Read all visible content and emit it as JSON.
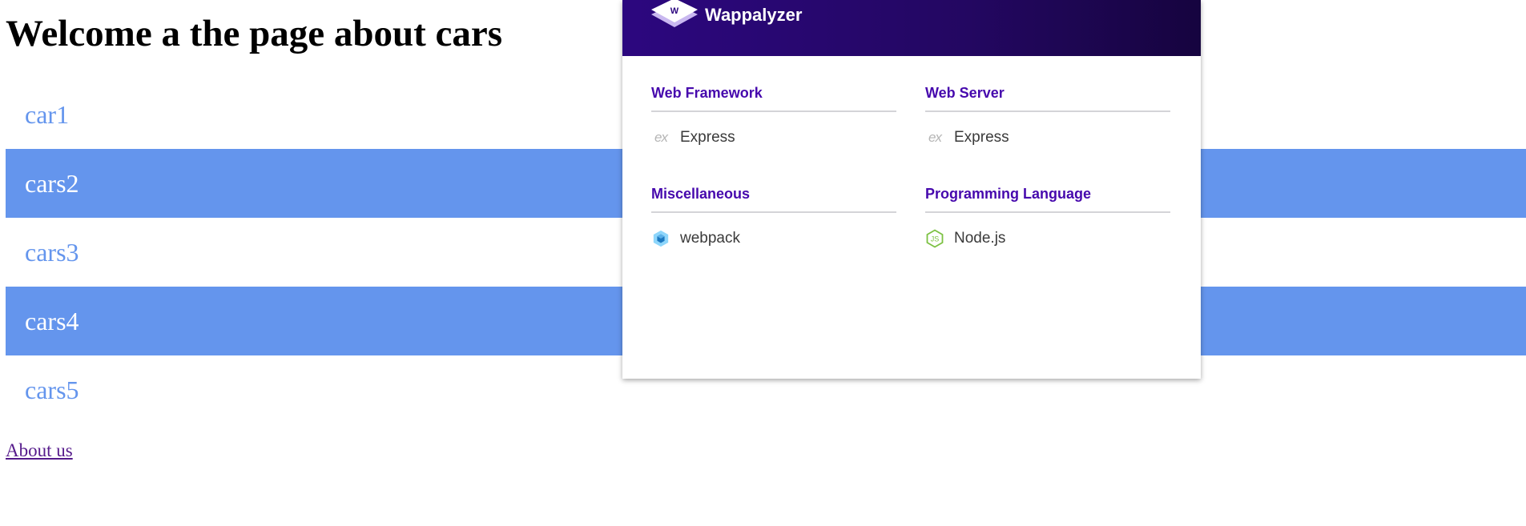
{
  "page": {
    "title": "Welcome a the page about cars",
    "cars": [
      {
        "label": "car1"
      },
      {
        "label": "cars2"
      },
      {
        "label": "cars3"
      },
      {
        "label": "cars4"
      },
      {
        "label": "cars5"
      }
    ],
    "about_link": "About us"
  },
  "wappalyzer": {
    "brand": "Wappalyzer",
    "categories": [
      {
        "title": "Web Framework",
        "tech": {
          "name": "Express",
          "icon": "express-icon",
          "glyph": "ex"
        }
      },
      {
        "title": "Web Server",
        "tech": {
          "name": "Express",
          "icon": "express-icon",
          "glyph": "ex"
        }
      },
      {
        "title": "Miscellaneous",
        "tech": {
          "name": "webpack",
          "icon": "webpack-icon"
        }
      },
      {
        "title": "Programming Language",
        "tech": {
          "name": "Node.js",
          "icon": "nodejs-icon"
        }
      }
    ]
  },
  "colors": {
    "car_accent": "#6495ed",
    "wappalyzer_purple": "#4608ad",
    "wappalyzer_header": "#2c077f",
    "link_visited": "#551a8b"
  }
}
